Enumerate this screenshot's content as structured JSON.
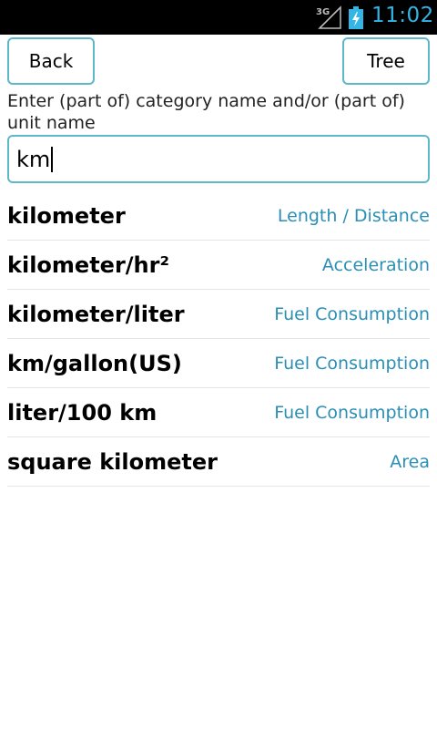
{
  "status_bar": {
    "network": "3G",
    "time": "11:02",
    "time_color": "#33b5e5"
  },
  "toolbar": {
    "back_label": "Back",
    "tree_label": "Tree"
  },
  "instruction": "Enter (part of) category name and/or (part of) unit name",
  "search": {
    "value": "km"
  },
  "results": [
    {
      "unit": "kilometer",
      "category": "Length / Distance"
    },
    {
      "unit": "kilometer/hr²",
      "category": "Acceleration"
    },
    {
      "unit": "kilometer/liter",
      "category": "Fuel Consumption"
    },
    {
      "unit": "km/gallon(US)",
      "category": "Fuel Consumption"
    },
    {
      "unit": "liter/100 km",
      "category": "Fuel Consumption"
    },
    {
      "unit": "square kilometer",
      "category": "Area"
    }
  ],
  "colors": {
    "accent": "#5fb8c7",
    "category_text": "#2b8fb5"
  }
}
